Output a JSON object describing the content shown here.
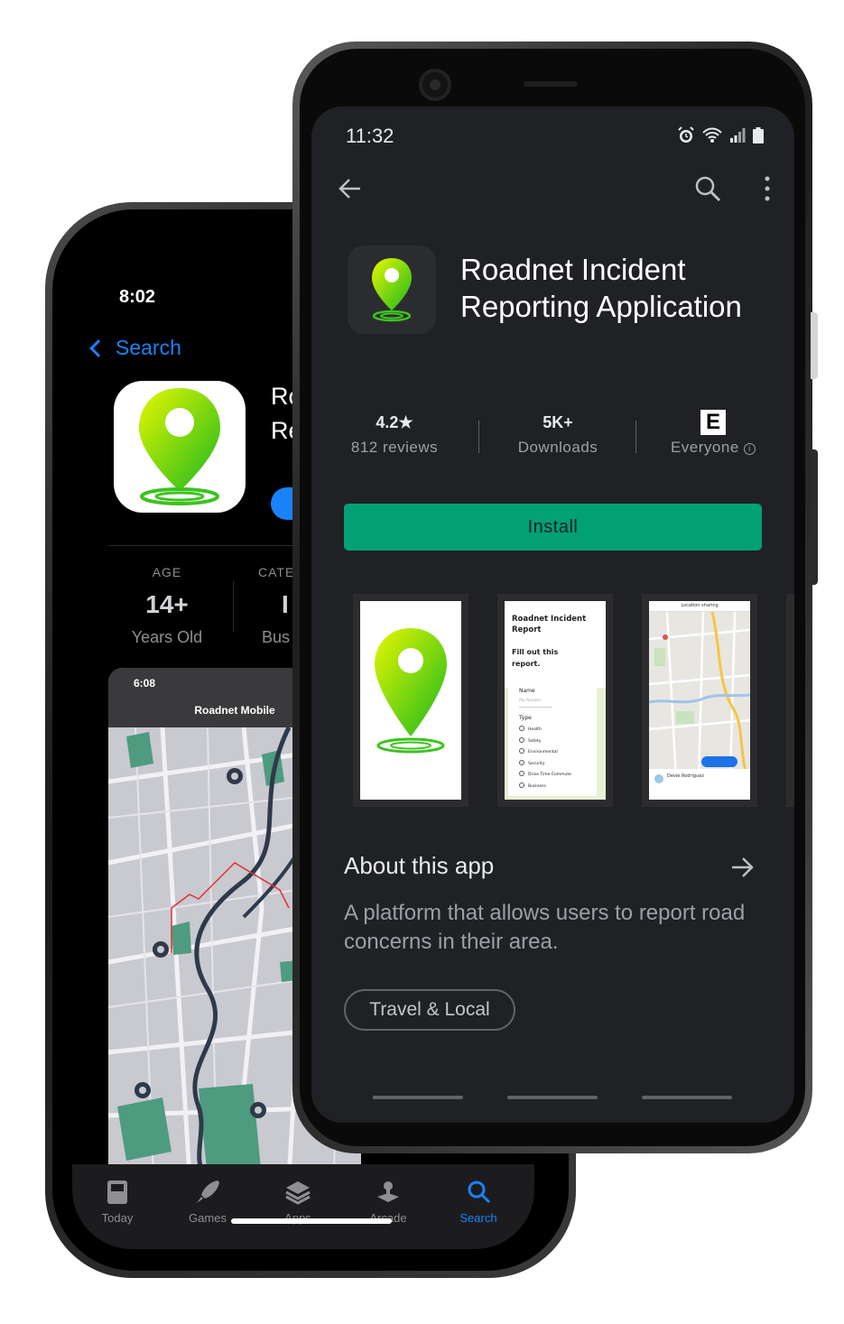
{
  "ios": {
    "time": "8:02",
    "back_label": "Search",
    "title_lines": [
      "Ro",
      "Re"
    ],
    "age": {
      "label": "AGE",
      "value": "14+",
      "sub": "Years Old"
    },
    "category": {
      "label": "CATE",
      "value": "I",
      "sub": "Bus"
    },
    "screenshot": {
      "time": "6:08",
      "title": "Roadnet Mobile"
    },
    "tabs": [
      {
        "label": "Today",
        "icon": "today-icon"
      },
      {
        "label": "Games",
        "icon": "rocket-icon"
      },
      {
        "label": "Apps",
        "icon": "layers-icon"
      },
      {
        "label": "Arcade",
        "icon": "joystick-icon"
      },
      {
        "label": "Search",
        "icon": "search-icon"
      }
    ],
    "active_tab": "Search"
  },
  "android": {
    "time": "11:32",
    "app_title_lines": [
      "Roadnet Incident",
      "Reporting Application"
    ],
    "rating": {
      "value": "4.2",
      "star": "★",
      "label": "812 reviews"
    },
    "downloads": {
      "value": "5K+",
      "label": "Downloads"
    },
    "content_rating": {
      "badge": "E",
      "label": "Everyone",
      "info": "i"
    },
    "install_label": "Install",
    "form_preview": {
      "title": "Roadnet Incident Report",
      "subtitle": "Fill out this report.",
      "name_label": "Name",
      "name_placeholder": "My Answer",
      "type_label": "Type",
      "options": [
        "Health",
        "Safety",
        "Environmental",
        "Security",
        "Drive Time Commute",
        "Business"
      ]
    },
    "location_preview": {
      "title": "Location sharing",
      "user": "Devie Rodriguez"
    },
    "about_title": "About this app",
    "description": "A platform that allows users to report road concerns in their area.",
    "category_chip": "Travel & Local"
  },
  "colors": {
    "install_green": "#01a173",
    "ios_blue": "#1a82f8",
    "android_bg": "#202124",
    "pin_green": "#3cc31e",
    "map_park": "#4e9b80"
  }
}
